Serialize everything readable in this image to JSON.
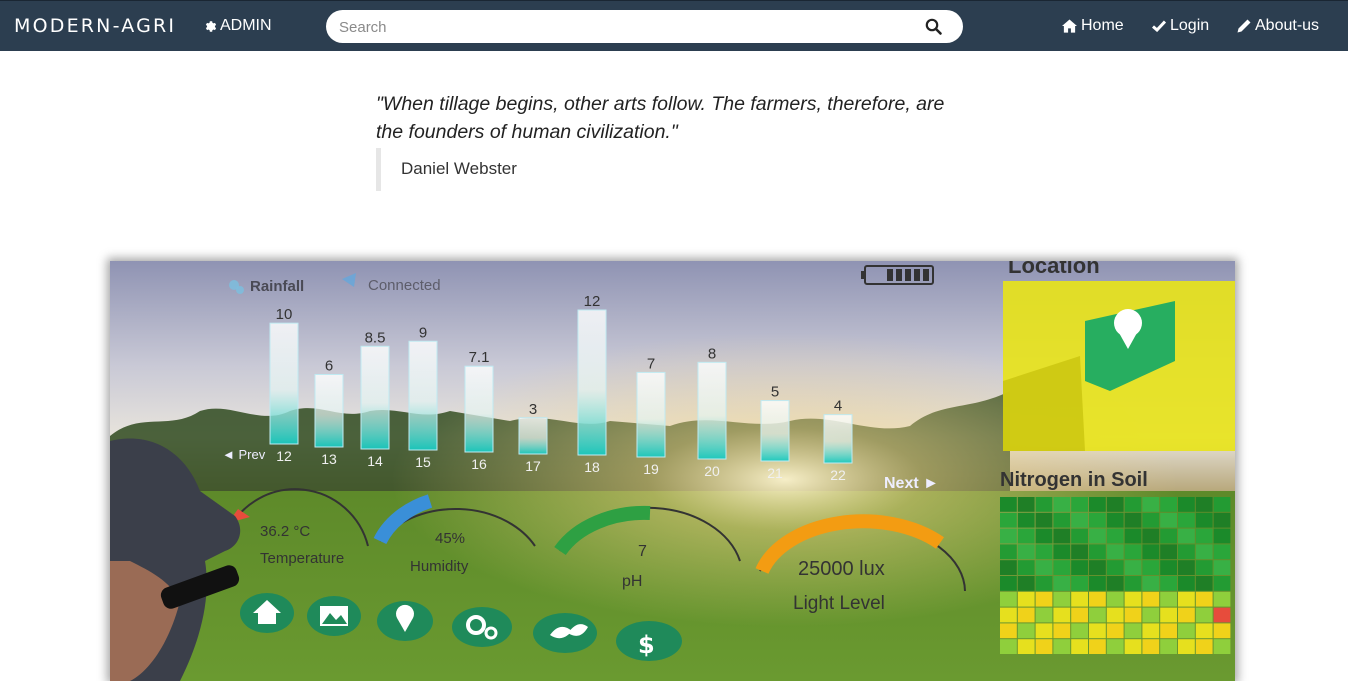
{
  "navbar": {
    "brand": "MODERN-AGRI",
    "admin_label": "ADMIN",
    "search_placeholder": "Search",
    "links": {
      "home": "Home",
      "login": "Login",
      "about": "About-us"
    }
  },
  "quote": {
    "text": "\"When tillage begins, other arts follow. The farmers, therefore, are the founders of human civilization.\"",
    "author": "Daniel Webster"
  },
  "hero": {
    "status": {
      "rainfall": "Rainfall",
      "connected": "Connected"
    },
    "chart_data": {
      "type": "bar",
      "categories": [
        "12",
        "13",
        "14",
        "15",
        "16",
        "17",
        "18",
        "19",
        "20",
        "21",
        "22"
      ],
      "values": [
        10,
        6,
        8.5,
        9,
        7.1,
        3,
        12,
        7,
        8,
        5,
        4
      ],
      "value_labels": [
        "10",
        "6",
        "8.5",
        "9",
        "7.1",
        "3",
        "12",
        "7",
        "8",
        "5",
        "4"
      ],
      "prev_label": "◄ Prev",
      "next_label": "Next ►",
      "ylim": [
        0,
        12
      ]
    },
    "gauges": {
      "temperature": {
        "value": "36.2 °C",
        "label": "Temperature"
      },
      "humidity": {
        "value": "45%",
        "label": "Humidity"
      },
      "ph": {
        "value": "7",
        "label": "pH"
      },
      "light": {
        "value": "25000 lux",
        "label": "Light Level"
      }
    },
    "panels": {
      "location": "Location",
      "nitrogen": "Nitrogen in Soil"
    },
    "icons": [
      "home-icon",
      "image-icon",
      "location-pin-icon",
      "gears-icon",
      "leaf-icon",
      "dollar-icon"
    ],
    "colors": {
      "bar_fill": "#1fd3c6",
      "gauge_orange": "#f39c12",
      "gauge_green": "#2ea043",
      "gauge_blue": "#3a8fd8",
      "map_yellow": "#e8e317"
    }
  }
}
